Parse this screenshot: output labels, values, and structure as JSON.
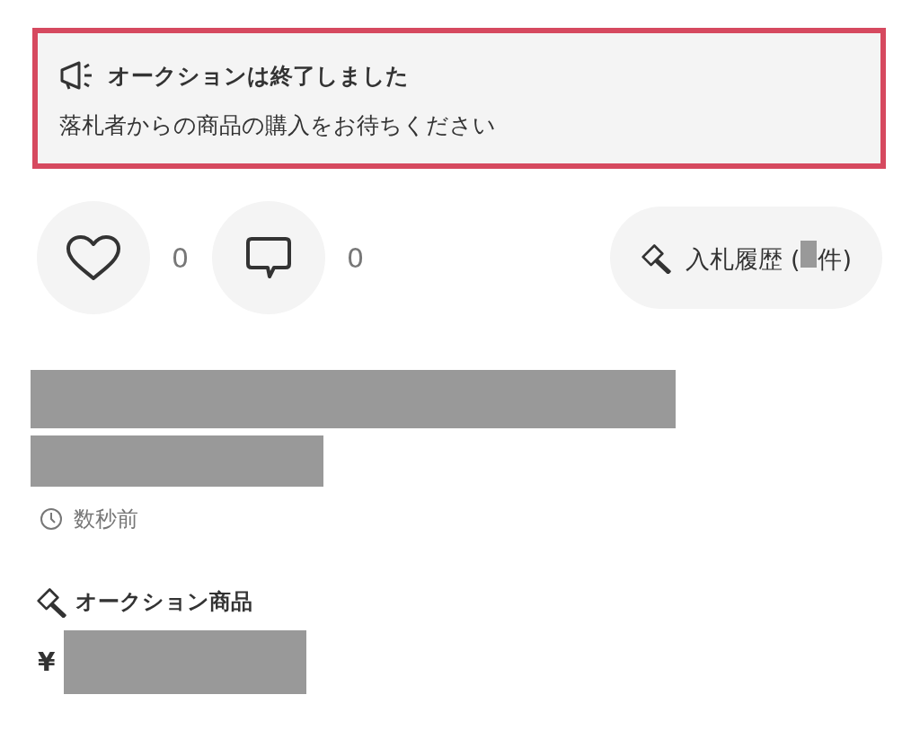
{
  "notice": {
    "title": "オークションは終了しました",
    "message": "落札者からの商品の購入をお待ちください"
  },
  "reactions": [
    {
      "kind": "like",
      "count": "0"
    },
    {
      "kind": "comment",
      "count": "0"
    }
  ],
  "bid_history_button": {
    "label_start": "入札履歴 (",
    "label_end": "件)"
  },
  "posted_time": "数秒前",
  "section": {
    "title": "オークション商品",
    "currency": "¥"
  }
}
